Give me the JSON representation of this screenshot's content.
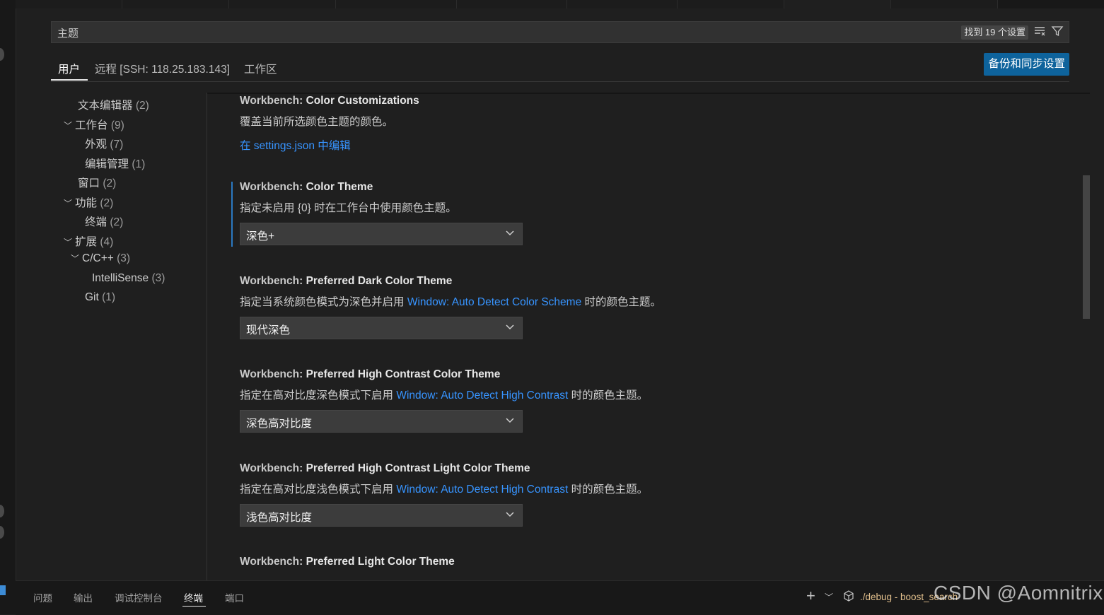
{
  "search": {
    "value": "主题",
    "result_count": "找到 19 个设置"
  },
  "scope_tabs": [
    {
      "label": "用户"
    },
    {
      "label": "远程 [SSH: 118.25.183.143]"
    },
    {
      "label": "工作区"
    }
  ],
  "sync_button": "备份和同步设置",
  "toc": [
    {
      "label": "文本编辑器",
      "count": "(2)",
      "expanded": null
    },
    {
      "label": "工作台",
      "count": "(9)",
      "expanded": true
    },
    {
      "label": "外观",
      "count": "(7)",
      "expanded": null
    },
    {
      "label": "编辑管理",
      "count": "(1)",
      "expanded": null
    },
    {
      "label": "窗口",
      "count": "(2)",
      "expanded": null
    },
    {
      "label": "功能",
      "count": "(2)",
      "expanded": true
    },
    {
      "label": "终端",
      "count": "(2)",
      "expanded": null
    },
    {
      "label": "扩展",
      "count": "(4)",
      "expanded": true
    },
    {
      "label": "C/C++",
      "count": "(3)",
      "expanded": true
    },
    {
      "label": "IntelliSense",
      "count": "(3)",
      "expanded": null
    },
    {
      "label": "Git",
      "count": "(1)",
      "expanded": null
    }
  ],
  "settings": [
    {
      "category": "Workbench: ",
      "name": "Color Customizations",
      "desc": "覆盖当前所选颜色主题的颜色。",
      "edit_link": "在 settings.json 中编辑"
    },
    {
      "category": "Workbench: ",
      "name": "Color Theme",
      "desc": "指定未启用 {0} 时在工作台中使用颜色主题。",
      "value": "深色+"
    },
    {
      "category": "Workbench: ",
      "name": "Preferred Dark Color Theme",
      "desc_pre": "指定当系统颜色模式为深色并启用 ",
      "desc_link": "Window: Auto Detect Color Scheme",
      "desc_post": " 时的颜色主题。",
      "value": "现代深色"
    },
    {
      "category": "Workbench: ",
      "name": "Preferred High Contrast Color Theme",
      "desc_pre": "指定在高对比度深色模式下启用 ",
      "desc_link": "Window: Auto Detect High Contrast",
      "desc_post": " 时的颜色主题。",
      "value": "深色高对比度"
    },
    {
      "category": "Workbench: ",
      "name": "Preferred High Contrast Light Color Theme",
      "desc_pre": "指定在高对比度浅色模式下启用 ",
      "desc_link": "Window: Auto Detect High Contrast",
      "desc_post": " 时的颜色主题。",
      "value": "浅色高对比度"
    },
    {
      "category": "Workbench: ",
      "name": "Preferred Light Color Theme"
    }
  ],
  "panel": {
    "tabs": [
      "问题",
      "输出",
      "调试控制台",
      "终端",
      "端口"
    ],
    "terminal_label": "./debug - boost_search"
  },
  "watermark": "CSDN @Aomnitrix",
  "colors": {
    "accent": "#0e639c",
    "link": "#3794ff",
    "focus": "#2b79c2",
    "terminal": "#e2c08d"
  }
}
